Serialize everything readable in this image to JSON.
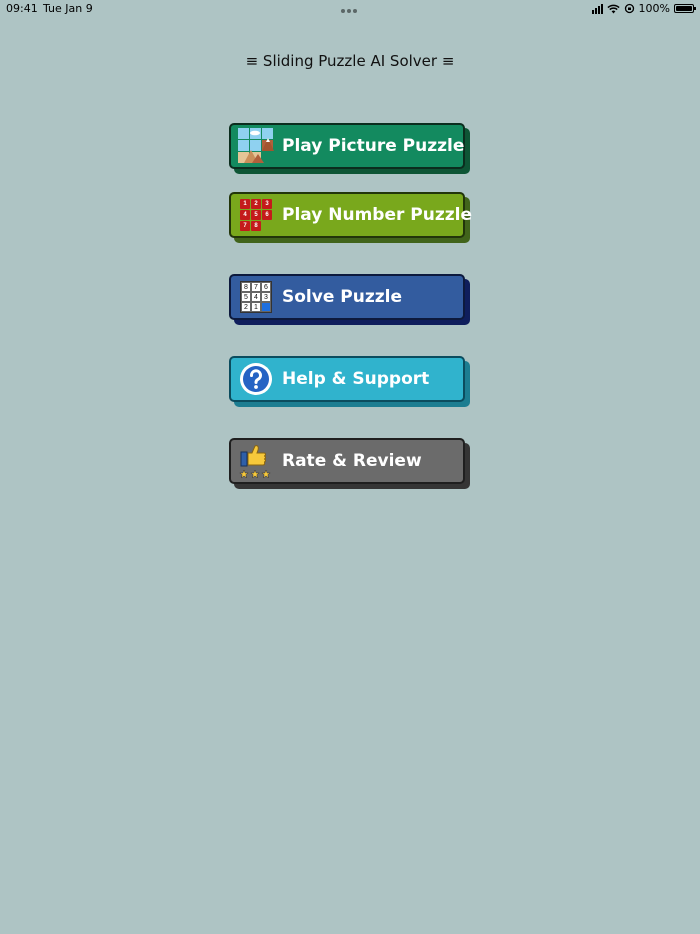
{
  "status_bar": {
    "time": "09:41",
    "date": "Tue Jan 9",
    "battery": "100%"
  },
  "app": {
    "title": "≡ Sliding Puzzle AI Solver ≡"
  },
  "menu": {
    "picture": {
      "label": "Play Picture Puzzle",
      "icon": "picture-puzzle-icon"
    },
    "number": {
      "label": "Play Number Puzzle",
      "icon": "number-grid-icon",
      "tiles": [
        "1",
        "2",
        "3",
        "4",
        "5",
        "6",
        "7",
        "8",
        ""
      ]
    },
    "solve": {
      "label": "Solve Puzzle",
      "icon": "solve-grid-icon",
      "tiles": [
        "8",
        "7",
        "6",
        "5",
        "4",
        "3",
        "2",
        "1",
        ""
      ]
    },
    "help": {
      "label": "Help & Support",
      "icon": "question-icon"
    },
    "rate": {
      "label": "Rate & Review",
      "icon": "thumbs-up-icon"
    }
  }
}
